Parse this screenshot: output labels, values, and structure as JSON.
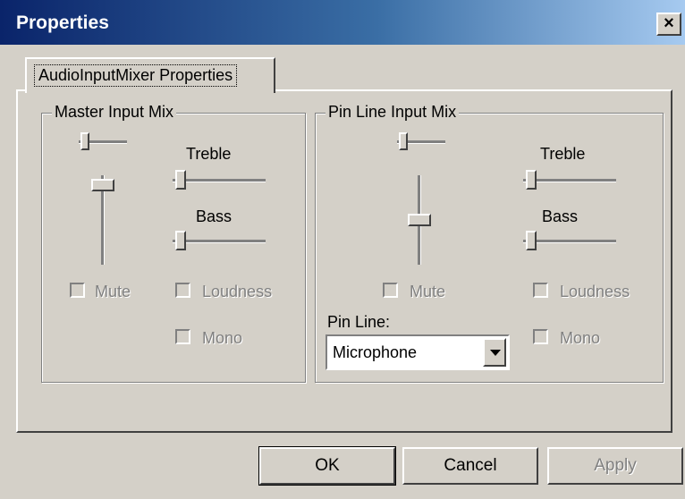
{
  "window": {
    "title": "Properties",
    "close_glyph": "×"
  },
  "tab": {
    "label": "AudioInputMixer Properties"
  },
  "master": {
    "title": "Master Input Mix",
    "treble_label": "Treble",
    "bass_label": "Bass",
    "mute_label": "Mute",
    "loudness_label": "Loudness",
    "mono_label": "Mono",
    "balance_level": 0.05,
    "volume_level": 0.95,
    "treble_level": 0.03,
    "bass_level": 0.03
  },
  "pin": {
    "title": "Pin Line Input Mix",
    "treble_label": "Treble",
    "bass_label": "Bass",
    "mute_label": "Mute",
    "loudness_label": "Loudness",
    "mono_label": "Mono",
    "pin_line_label": "Pin Line:",
    "pin_line_value": "Microphone",
    "balance_level": 0.05,
    "volume_level": 0.5,
    "treble_level": 0.03,
    "bass_level": 0.03
  },
  "buttons": {
    "ok": "OK",
    "cancel": "Cancel",
    "apply": "Apply"
  },
  "colors": {
    "face": "#d4d0c8",
    "titlebar_start": "#0a246a",
    "titlebar_end": "#a6caf0",
    "disabled_text": "#808080"
  }
}
